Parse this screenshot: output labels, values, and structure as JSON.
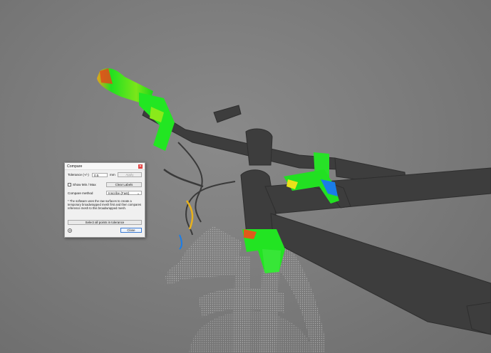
{
  "dialog": {
    "title": "Compare",
    "close_glyph": "✕",
    "tolerance": {
      "label": "Tolerance (+/-)",
      "value": "0.5",
      "unit": "mm",
      "apply_label": "Apply"
    },
    "show_min_max": {
      "label": "Show Min / Max",
      "checked": false
    },
    "clear_labels_label": "Clear Labels",
    "compare_method": {
      "label": "Compare method",
      "selected": "Inscribe (Fast)"
    },
    "note": "* The software uses the raw surfaces to create a temporary broadwrapped mesh first and then compares reference mesh to this broadwrapped mesh.",
    "select_all_label": "Select all points in tolerance",
    "help_glyph": "?",
    "close_label": "Close"
  },
  "viewport": {
    "mesh_color": "#3d3d3d",
    "ghost_color": "#a6a6a6",
    "heatmap_colors": [
      "#18e818",
      "#7fea18",
      "#e9e21a",
      "#e04a1a",
      "#1a7de8"
    ]
  }
}
